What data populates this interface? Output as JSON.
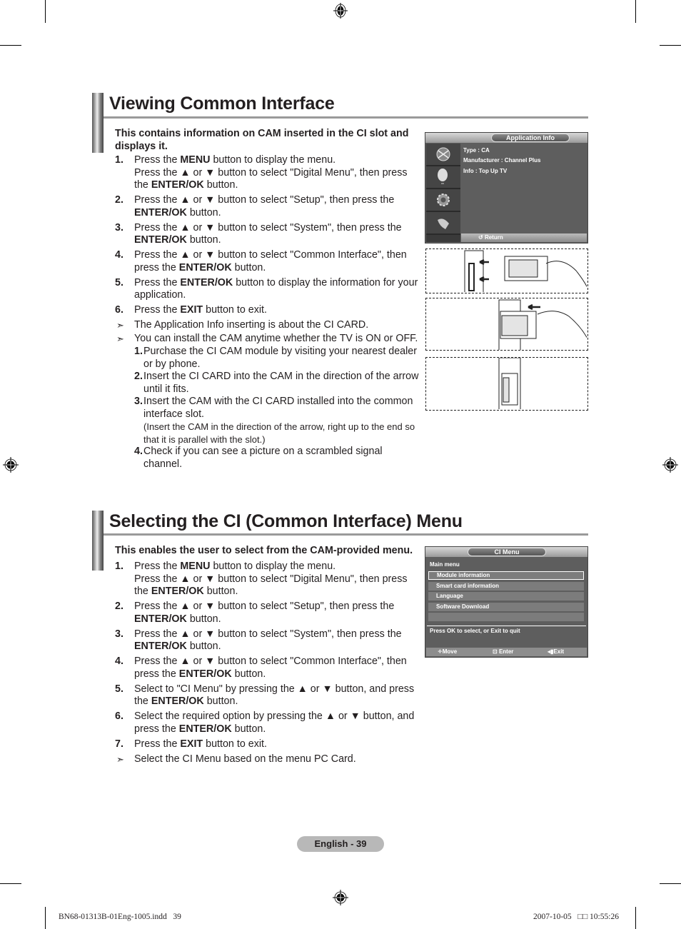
{
  "sections": [
    {
      "title": "Viewing Common Interface",
      "intro": "This contains information on CAM inserted in the CI slot and displays it.",
      "steps": [
        {
          "num": "1.",
          "lines": [
            [
              {
                "t": "Press the "
              },
              {
                "b": "MENU"
              },
              {
                "t": " button to display the menu."
              }
            ],
            [
              {
                "t": "Press the ▲ or ▼ button to select \"Digital Menu\", then press the "
              },
              {
                "b": "ENTER/OK"
              },
              {
                "t": " button."
              }
            ]
          ]
        },
        {
          "num": "2.",
          "lines": [
            [
              {
                "t": "Press the ▲ or ▼ button to select \"Setup\", then press the "
              },
              {
                "b": "ENTER/OK"
              },
              {
                "t": " button."
              }
            ]
          ]
        },
        {
          "num": "3.",
          "lines": [
            [
              {
                "t": "Press the ▲ or ▼ button to select \"System\", then press the "
              },
              {
                "b": "ENTER/OK"
              },
              {
                "t": " button."
              }
            ]
          ]
        },
        {
          "num": "4.",
          "lines": [
            [
              {
                "t": "Press the ▲ or ▼ button to select \"Common Interface\", then press the "
              },
              {
                "b": "ENTER/OK"
              },
              {
                "t": " button."
              }
            ]
          ]
        },
        {
          "num": "5.",
          "lines": [
            [
              {
                "t": "Press the "
              },
              {
                "b": "ENTER/OK"
              },
              {
                "t": " button to display the information for your application."
              }
            ]
          ]
        },
        {
          "num": "6.",
          "lines": [
            [
              {
                "t": "Press the "
              },
              {
                "b": "EXIT"
              },
              {
                "t": " button to exit."
              }
            ]
          ]
        }
      ],
      "notes": [
        "The Application Info inserting is about the CI CARD.",
        "You can install the CAM anytime whether the TV is ON or OFF."
      ],
      "substeps": [
        {
          "num": "1.",
          "text": "Purchase the CI CAM module by visiting your nearest dealer or by phone."
        },
        {
          "num": "2.",
          "text": "Insert the CI CARD into the CAM in the direction of the arrow until it fits."
        },
        {
          "num": "3.",
          "text": "Insert the CAM with the CI CARD installed into the common interface slot.",
          "small": "(Insert the CAM in the direction of the arrow, right up to the end so that it is parallel with the slot.)"
        },
        {
          "num": "4.",
          "text": " Check if you can see a picture on a scrambled signal channel."
        }
      ]
    },
    {
      "title": "Selecting the CI (Common Interface) Menu",
      "intro": "This enables the user to select from the CAM-provided menu.",
      "steps": [
        {
          "num": "1.",
          "lines": [
            [
              {
                "t": "Press the "
              },
              {
                "b": "MENU"
              },
              {
                "t": " button to display the menu."
              }
            ],
            [
              {
                "t": "Press the ▲ or ▼ button to select \"Digital Menu\", then press the "
              },
              {
                "b": "ENTER/OK"
              },
              {
                "t": " button."
              }
            ]
          ]
        },
        {
          "num": "2.",
          "lines": [
            [
              {
                "t": "Press the ▲ or ▼ button to select \"Setup\", then press the "
              },
              {
                "b": "ENTER/OK"
              },
              {
                "t": " button."
              }
            ]
          ]
        },
        {
          "num": "3.",
          "lines": [
            [
              {
                "t": "Press the ▲ or ▼ button to select \"System\", then press the "
              },
              {
                "b": "ENTER/OK"
              },
              {
                "t": " button."
              }
            ]
          ]
        },
        {
          "num": "4.",
          "lines": [
            [
              {
                "t": "Press the ▲ or ▼ button to select \"Common Interface\", then press the "
              },
              {
                "b": "ENTER/OK"
              },
              {
                "t": " button."
              }
            ]
          ]
        },
        {
          "num": "5.",
          "lines": [
            [
              {
                "t": "Select to \"CI Menu\" by pressing the ▲ or ▼ button, and press the "
              },
              {
                "b": "ENTER/OK"
              },
              {
                "t": " button."
              }
            ]
          ]
        },
        {
          "num": "6.",
          "lines": [
            [
              {
                "t": "Select the required option by pressing the ▲ or ▼ button, and press the "
              },
              {
                "b": "ENTER/OK"
              },
              {
                "t": " button."
              }
            ]
          ]
        },
        {
          "num": "7.",
          "lines": [
            [
              {
                "t": "Press the "
              },
              {
                "b": "EXIT"
              },
              {
                "t": " button to exit."
              }
            ]
          ]
        }
      ],
      "notes": [
        "Select the CI Menu based on the menu PC Card."
      ]
    }
  ],
  "app_info_osd": {
    "title": "Application Info",
    "lines": [
      "Type : CA",
      "Manufacturer : Channel Plus",
      "Info : Top Up TV"
    ],
    "return_label": "Return",
    "side_icons": [
      "satellite-dish-icon",
      "antenna-icon",
      "gear-icon",
      "remote-icon"
    ]
  },
  "ci_menu_osd": {
    "title": "CI Menu",
    "subtitle": "Main menu",
    "items": [
      "Module information",
      "Smart card information",
      "Language",
      "Software Download",
      ""
    ],
    "selected_index": 0,
    "hint": "Press OK to select, or Exit to quit",
    "footer": {
      "move": "Move",
      "enter": "Enter",
      "exit": "Exit"
    }
  },
  "illustrations": [
    "CAM insertion step 1",
    "CAM insertion step 2",
    "CAM inserted"
  ],
  "page_label": "English - 39",
  "slug": {
    "file": "BN68-01313B-01Eng-1005.indd   39",
    "timestamp": "2007-10-05   □□ 10:55:26"
  },
  "note_marker": "➣"
}
